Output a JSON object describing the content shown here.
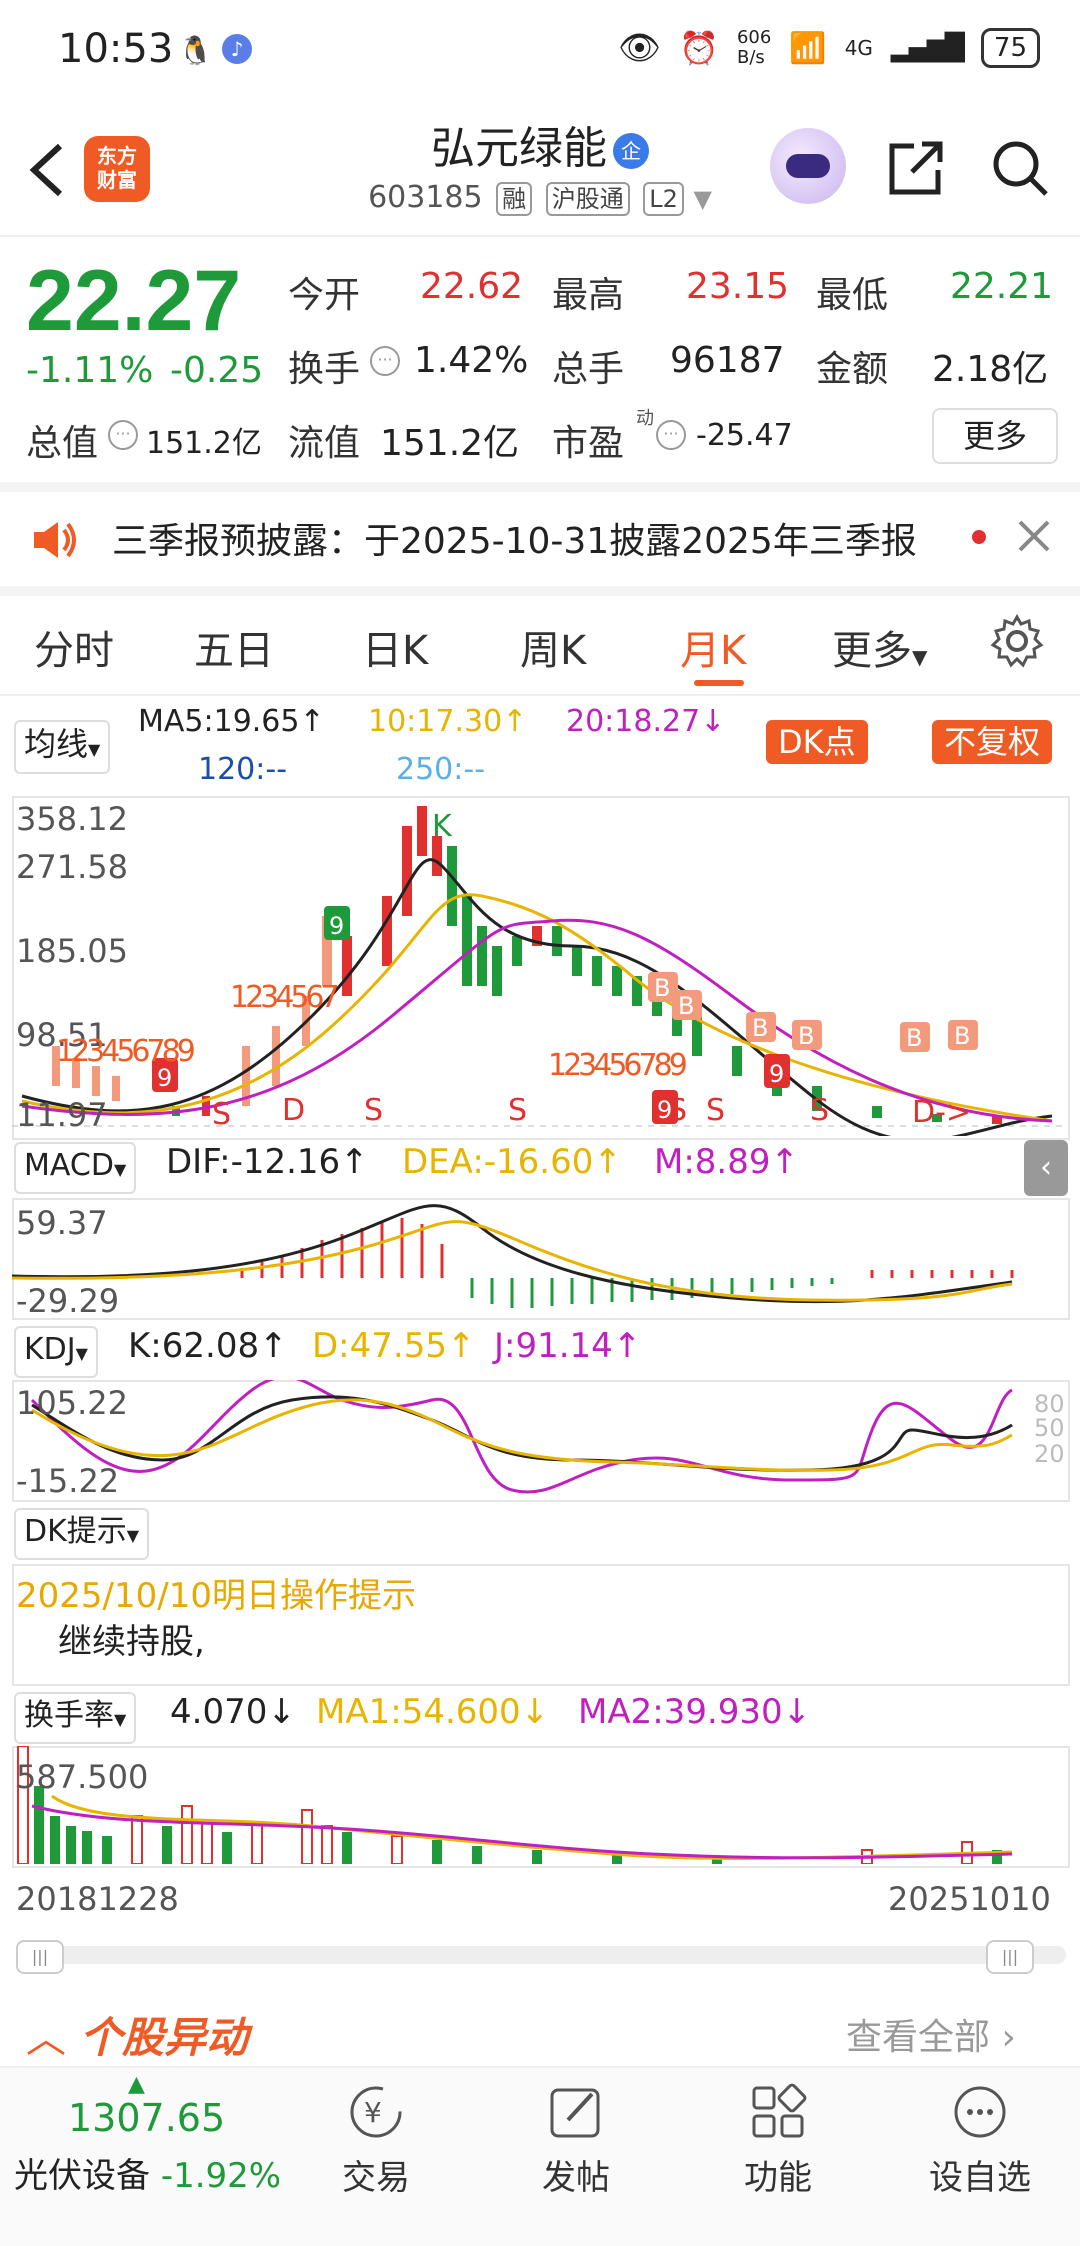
{
  "status": {
    "time": "10:53",
    "net_speed": "606\nB/s",
    "network": "4G",
    "battery": "75"
  },
  "header": {
    "logo": "东方\n财富",
    "name": "弘元绿能",
    "name_badge": "企",
    "code": "603185",
    "tags": [
      "融",
      "沪股通",
      "L2"
    ]
  },
  "quote": {
    "price": "22.27",
    "change_pct": "-1.11%",
    "change": "-0.25",
    "open_label": "今开",
    "open": "22.62",
    "high_label": "最高",
    "high": "23.15",
    "low_label": "最低",
    "low": "22.21",
    "turnover_label": "换手",
    "turnover": "1.42%",
    "volume_label": "总手",
    "volume": "96187",
    "amount_label": "金额",
    "amount": "2.18亿",
    "mktcap_label": "总值",
    "mktcap": "151.2亿",
    "float_label": "流值",
    "float": "151.2亿",
    "pe_label": "市盈",
    "pe_sup": "动",
    "pe": "-25.47",
    "more": "更多"
  },
  "notice": {
    "text": "三季报预披露：于2025-10-31披露2025年三季报"
  },
  "tabs": [
    "分时",
    "五日",
    "日K",
    "周K",
    "月K",
    "更多"
  ],
  "active_tab": "月K",
  "kline": {
    "indicator_select": "均线",
    "ma5": "MA5:19.65↑",
    "ma10": "10:17.30↑",
    "ma20": "20:18.27↓",
    "ma120": "120:--",
    "ma250": "250:--",
    "dk_btn": "DK点",
    "fq_btn": "不复权",
    "y_labels": [
      "358.12",
      "271.58",
      "185.05",
      "98.51",
      "11.97"
    ],
    "signals": [
      "S",
      "D",
      "S",
      "S",
      "S",
      "S",
      "S",
      "D->",
      "K",
      "B"
    ],
    "seq_labels": [
      "123456789",
      "1234567",
      "8",
      "9"
    ]
  },
  "macd": {
    "select": "MACD",
    "dif": "DIF:-12.16↑",
    "dea": "DEA:-16.60↑",
    "m": "M:8.89↑",
    "y_top": "59.37",
    "y_bottom": "-29.29"
  },
  "kdj": {
    "select": "KDJ",
    "k": "K:62.08↑",
    "d": "D:47.55↑",
    "j": "J:91.14↑",
    "y_top": "105.22",
    "y_bottom": "-15.22",
    "levels": [
      "80",
      "50",
      "20"
    ]
  },
  "dk": {
    "select": "DK提示",
    "title": "2025/10/10明日操作提示",
    "text": "继续持股,"
  },
  "turnover_panel": {
    "select": "换手率",
    "value": "4.070↓",
    "ma1": "MA1:54.600↓",
    "ma2": "MA2:39.930↓",
    "y_top": "587.500",
    "date_start": "20181228",
    "date_end": "20251010"
  },
  "abnormal": {
    "title": "个股异动",
    "view_all": "查看全部"
  },
  "bottom_nav": {
    "index_value": "1307.65",
    "index_name": "光伏设备",
    "index_change": "-1.92%",
    "items": [
      "交易",
      "发帖",
      "功能",
      "设自选"
    ]
  },
  "colors": {
    "up": "#e03030",
    "down": "#1e9a3a",
    "accent": "#f05a24",
    "ma5": "#222222",
    "ma10": "#e8b400",
    "ma20": "#c020c0"
  }
}
